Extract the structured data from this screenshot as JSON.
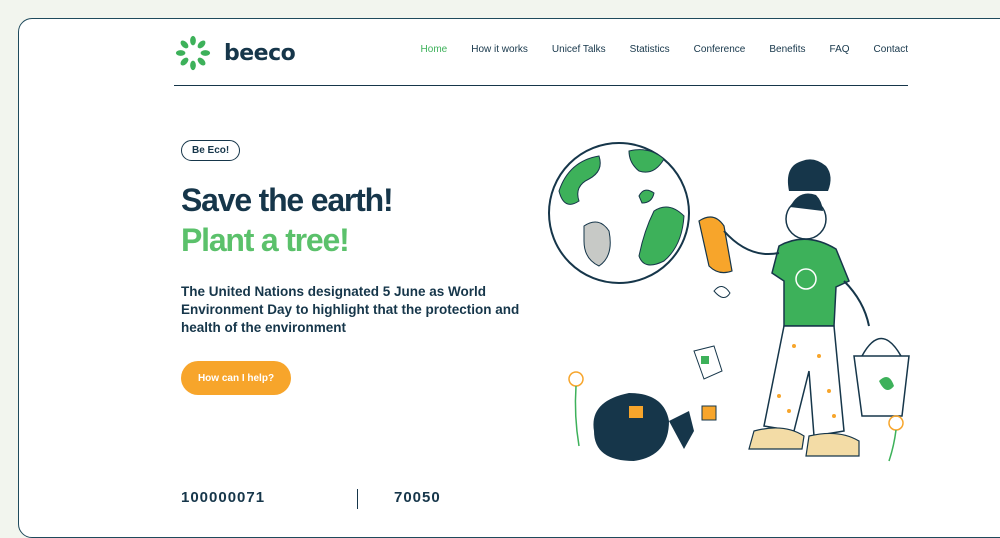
{
  "brand": {
    "name": "beeco",
    "primary_color": "#16364a",
    "accent_color": "#5bc16b",
    "cta_color": "#f7a52b"
  },
  "nav": {
    "items": [
      {
        "label": "Home",
        "active": true
      },
      {
        "label": "How it works",
        "active": false
      },
      {
        "label": "Unicef Talks",
        "active": false
      },
      {
        "label": "Statistics",
        "active": false
      },
      {
        "label": "Conference",
        "active": false
      },
      {
        "label": "Benefits",
        "active": false
      },
      {
        "label": "FAQ",
        "active": false
      },
      {
        "label": "Contact",
        "active": false
      }
    ]
  },
  "hero": {
    "badge": "Be Eco!",
    "headline": "Save the earth!",
    "subheadline": "Plant a tree!",
    "description": "The United Nations designated 5 June as World Environment Day to highlight that the protection and health of the environment",
    "cta_label": "How can I help?"
  },
  "stats": {
    "first_value": "100000071",
    "second_value": "70050"
  },
  "illustration": {
    "icon": "eco-person-cleaning-globe-illustration"
  }
}
